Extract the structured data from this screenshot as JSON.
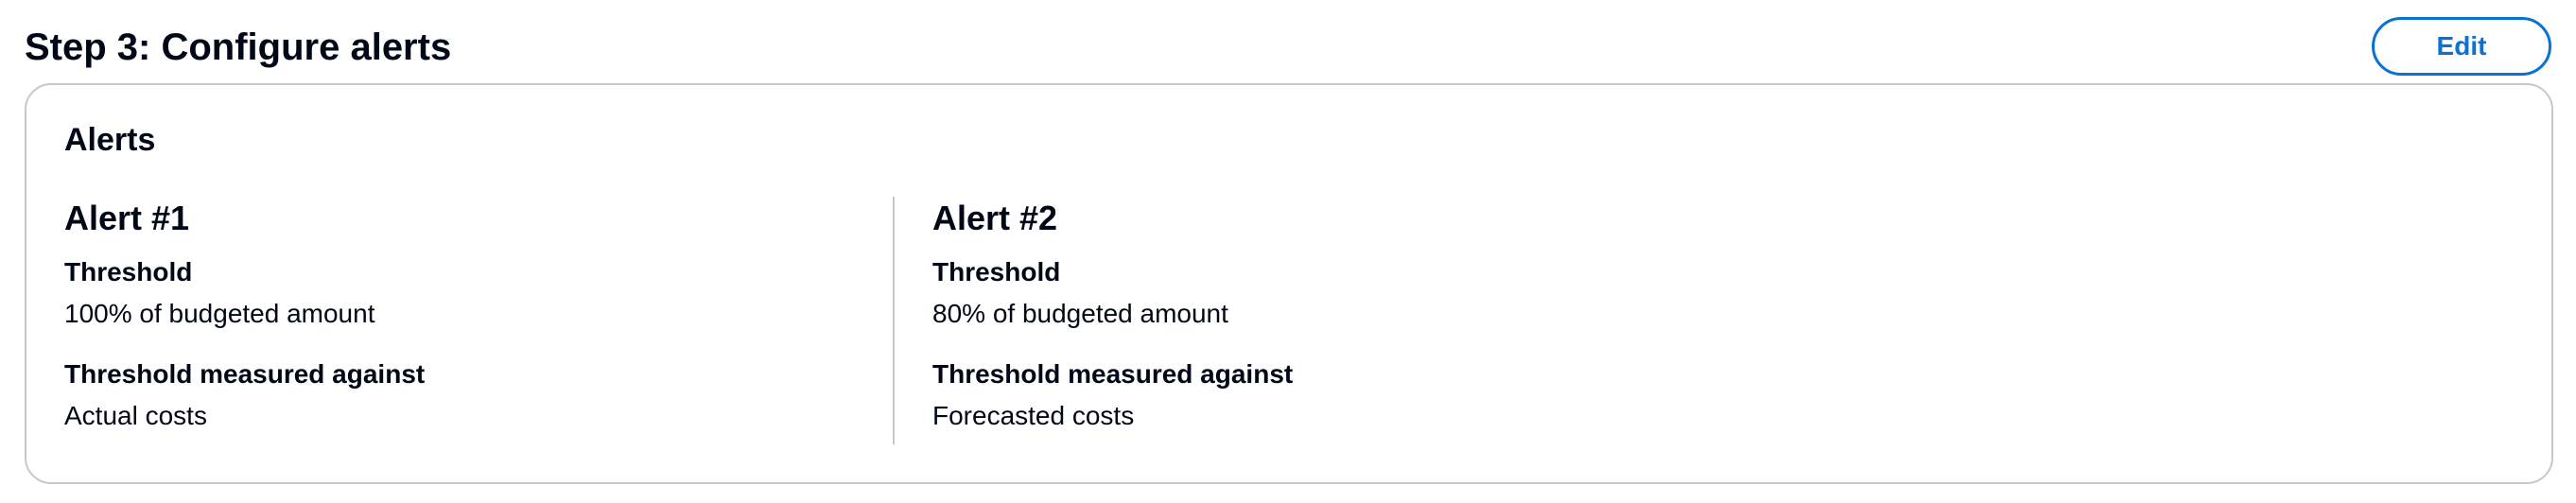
{
  "step": {
    "title": "Step 3: Configure alerts",
    "edit_label": "Edit"
  },
  "card": {
    "title": "Alerts",
    "alerts": [
      {
        "title": "Alert #1",
        "threshold_label": "Threshold",
        "threshold_value": "100% of budgeted amount",
        "measured_label": "Threshold measured against",
        "measured_value": "Actual costs"
      },
      {
        "title": "Alert #2",
        "threshold_label": "Threshold",
        "threshold_value": "80% of budgeted amount",
        "measured_label": "Threshold measured against",
        "measured_value": "Forecasted costs"
      }
    ]
  },
  "colors": {
    "accent": "#0972d3",
    "text": "#000716",
    "border": "#c6c6cd"
  }
}
